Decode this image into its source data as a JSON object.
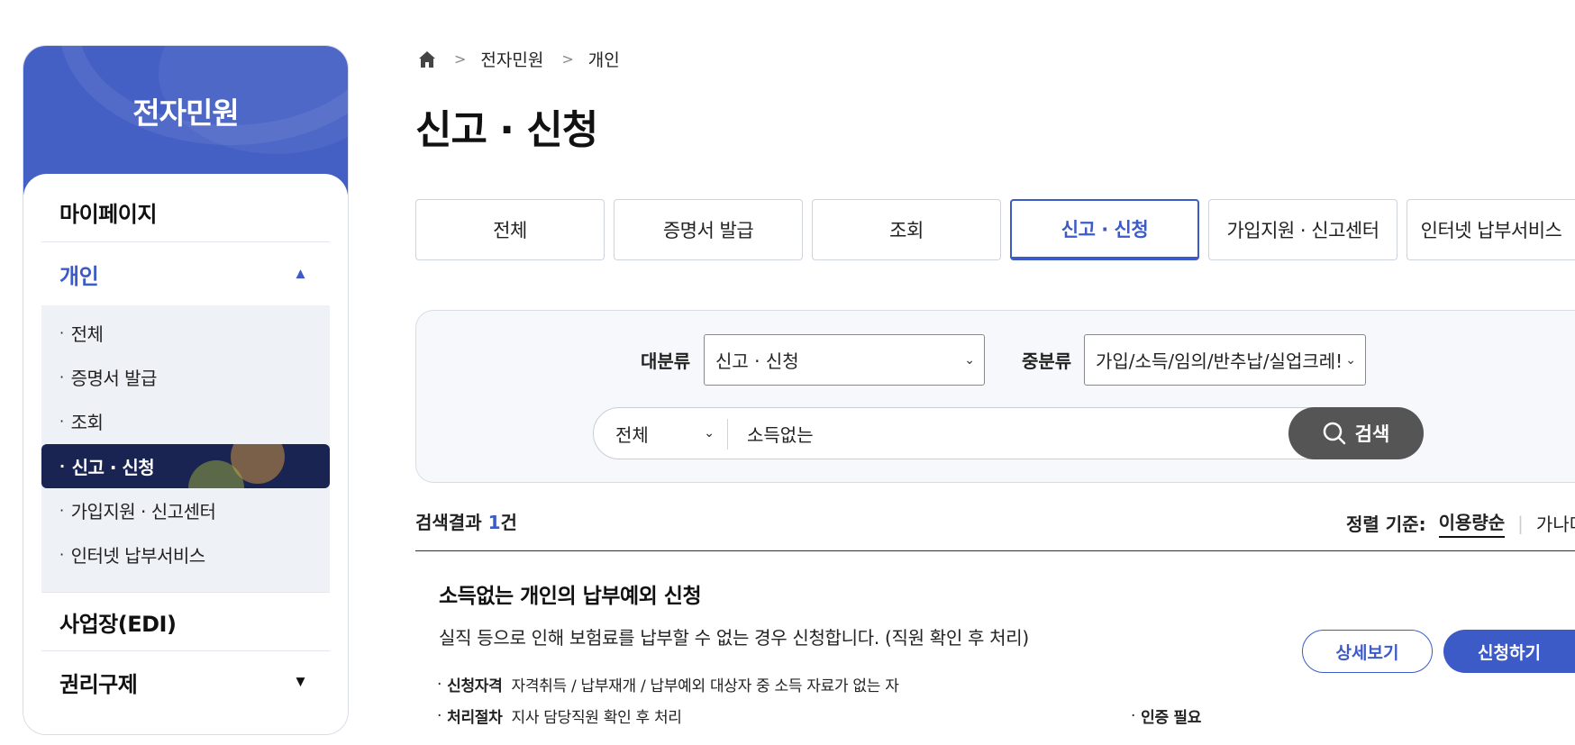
{
  "sidebar": {
    "title": "전자민원",
    "menu": [
      {
        "label": "마이페이지"
      },
      {
        "label": "개인",
        "caret": "▲"
      },
      {
        "label": "사업장(EDI)"
      },
      {
        "label": "권리구제",
        "caret": "▼"
      }
    ],
    "submenu": [
      {
        "label": "전체"
      },
      {
        "label": "증명서 발급"
      },
      {
        "label": "조회"
      },
      {
        "label": "신고 · 신청"
      },
      {
        "label": "가입지원 · 신고센터"
      },
      {
        "label": "인터넷 납부서비스"
      }
    ],
    "bullet": "·"
  },
  "breadcrumb": {
    "home_icon": "home-icon",
    "sep": ">",
    "items": [
      "전자민원",
      "개인"
    ]
  },
  "page_title": "신고 · 신청",
  "tabs": [
    "전체",
    "증명서 발급",
    "조회",
    "신고 · 신청",
    "가입지원 · 신고센터",
    "인터넷 납부서비스"
  ],
  "active_tab": "신고 · 신청",
  "filters": {
    "major_label": "대분류",
    "major_value": "신고 · 신청",
    "minor_label": "중분류",
    "minor_value": "가입/소득/임의/반추납/실업크레!",
    "chevron": "⌄"
  },
  "search": {
    "scope_value": "전체",
    "query": "소득없는",
    "button_label": "검색"
  },
  "results": {
    "prefix": "검색결과 ",
    "count": "1",
    "suffix": "건",
    "sort_label": "정렬 기준:",
    "sort_active": "이용량순",
    "sort_next": "가나다",
    "sort_sep": "|"
  },
  "item": {
    "title": "소득없는 개인의 납부예외 신청",
    "desc": "실직 등으로 인해 보험료를 납부할 수 없는 경우 신청합니다. (직원 확인 후 처리)",
    "detail_button": "상세보기",
    "apply_button": "신청하기",
    "eligibility_key": "신청자격",
    "eligibility_value": "자격취득 / 납부재개 / 납부예외 대상자 중 소득 자료가 없는 자",
    "process_key": "처리절차",
    "process_value": "지사 담당직원 확인 후 처리",
    "auth_required": "인증 필요"
  },
  "colors": {
    "brand": "#4560c4",
    "active_sub": "#1a2452",
    "accent": "#3d5bc7"
  }
}
